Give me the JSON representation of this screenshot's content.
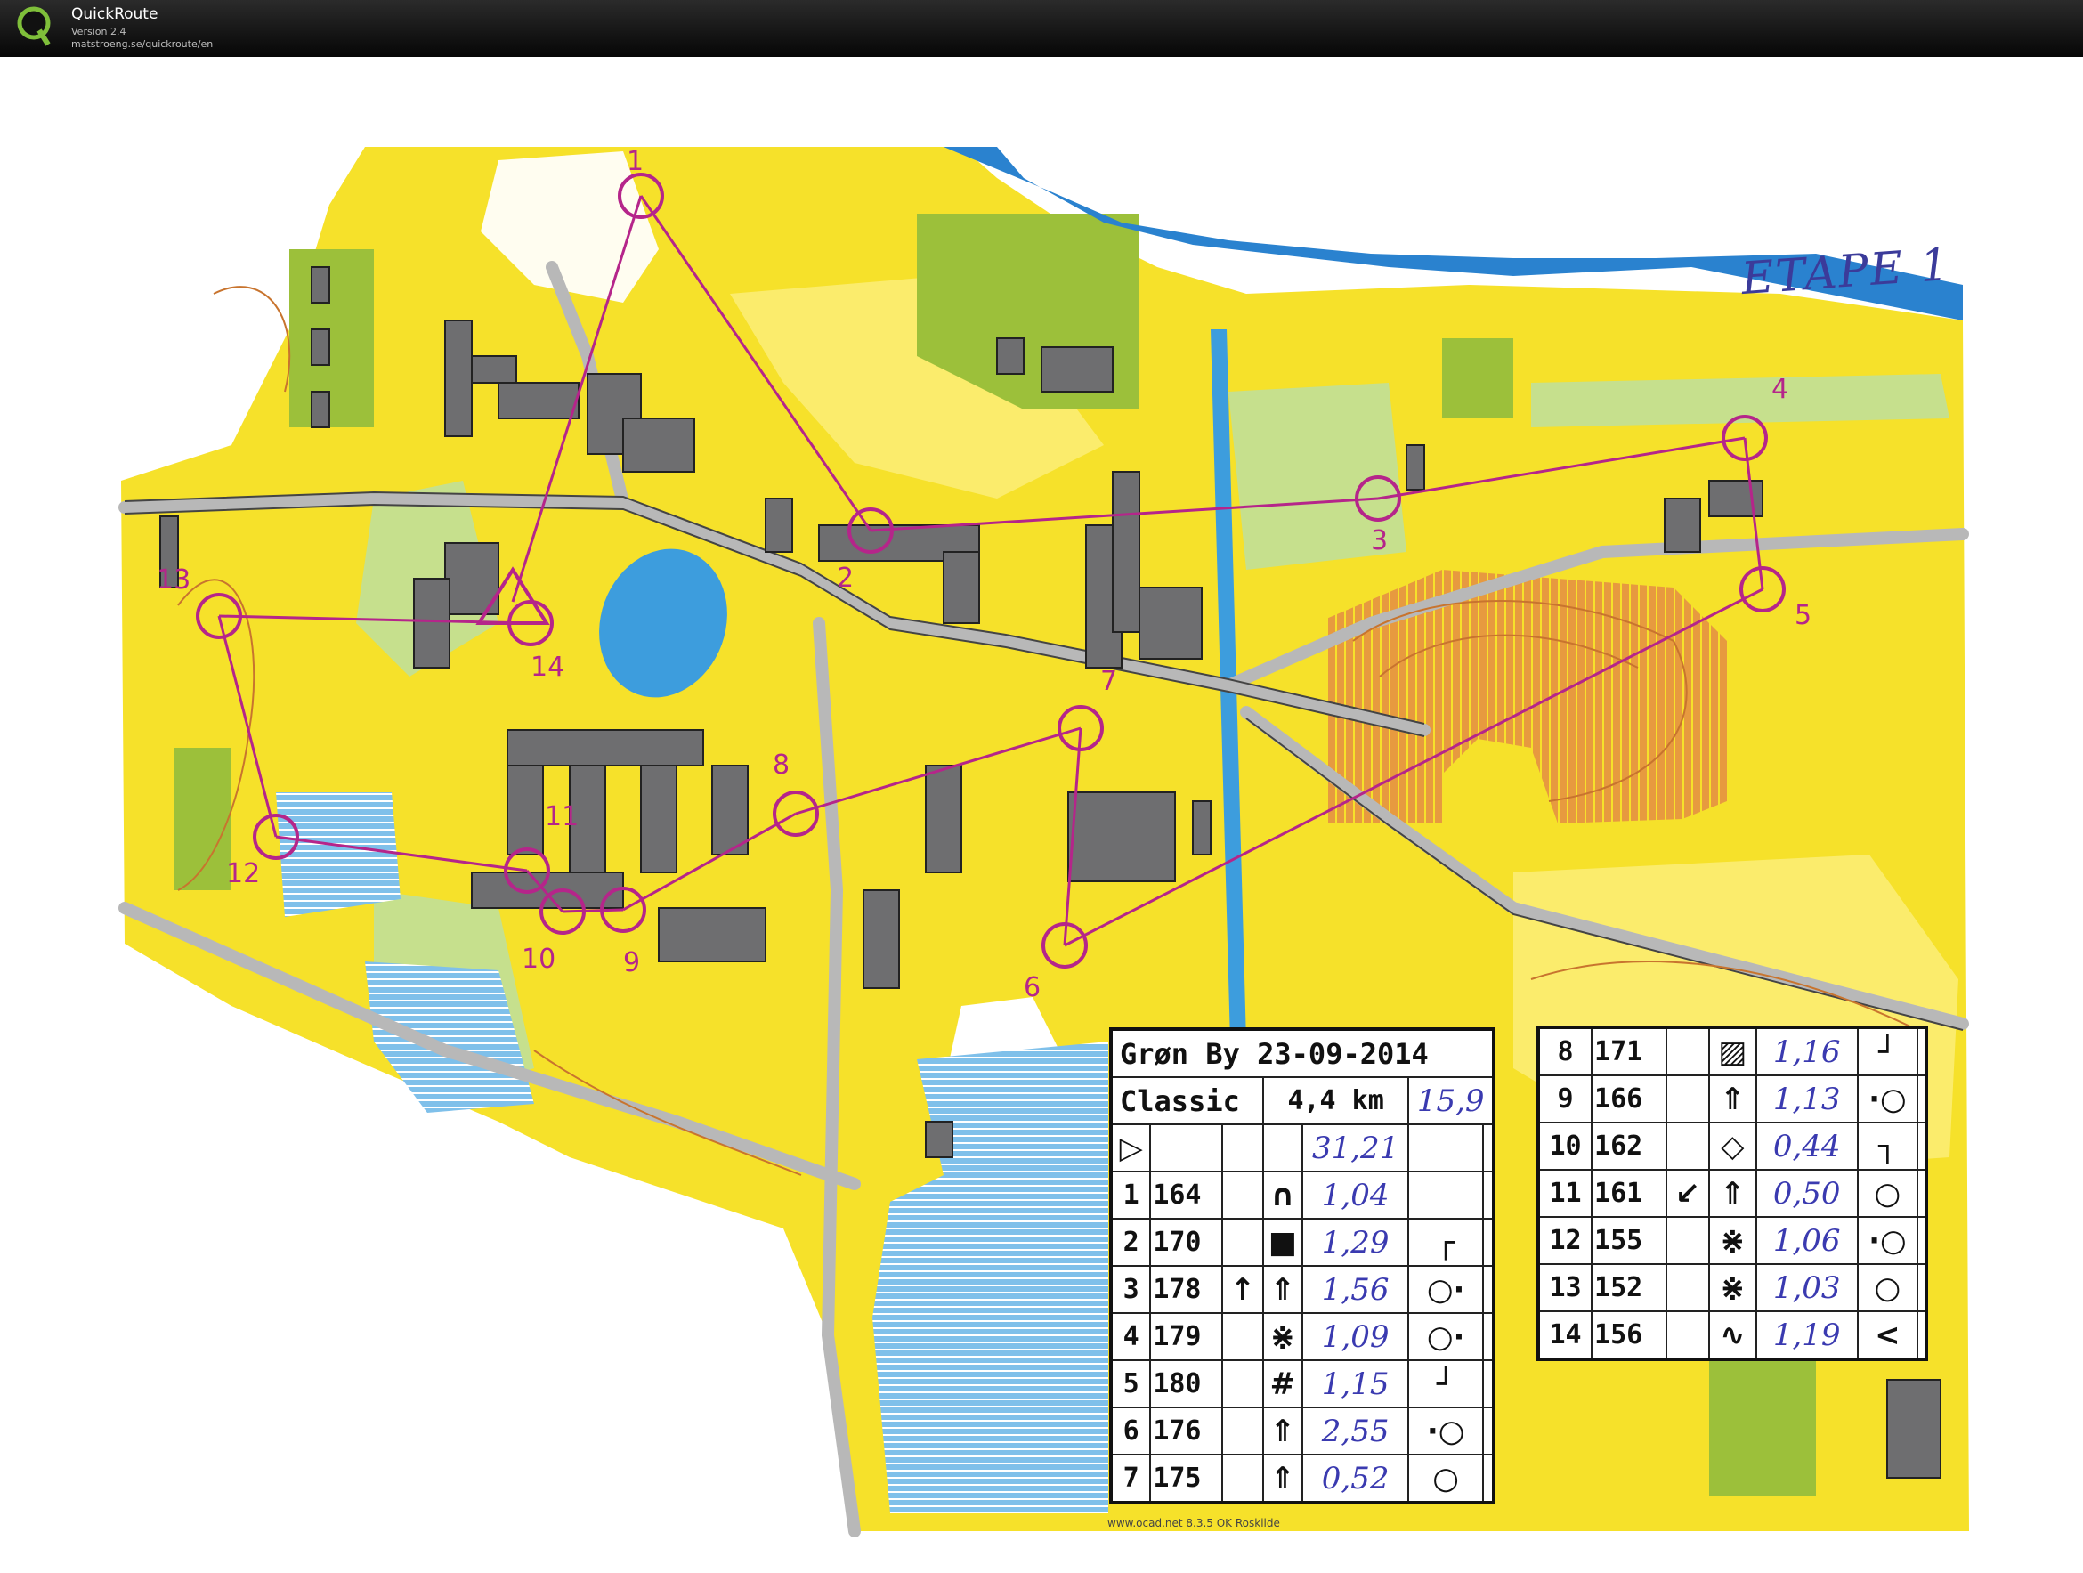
{
  "app": {
    "title": "QuickRoute",
    "version": "Version 2.4",
    "url": "matstroeng.se/quickroute/en"
  },
  "map": {
    "stage_note": "ETAPE 1",
    "footer": "www.ocad.net 8.3.5 OK Roskilde",
    "colors": {
      "open_land": "#f6e12a",
      "rough_open": "#fbec6c",
      "forest": "#ffffff",
      "green_dense": "#9cc03a",
      "green_light": "#c6e08d",
      "water": "#3d9ddd",
      "building": "#6e6e70",
      "paved": "#d8d8d8",
      "course": "#b5258a",
      "contour": "#c8742e"
    },
    "controls": [
      {
        "label": "1"
      },
      {
        "label": "2"
      },
      {
        "label": "3"
      },
      {
        "label": "4"
      },
      {
        "label": "5"
      },
      {
        "label": "6"
      },
      {
        "label": "7"
      },
      {
        "label": "8"
      },
      {
        "label": "9"
      },
      {
        "label": "10"
      },
      {
        "label": "11"
      },
      {
        "label": "12"
      },
      {
        "label": "13"
      },
      {
        "label": "14"
      }
    ]
  },
  "description": {
    "event_header": "Grøn By 23-09-2014",
    "class_name": "Classic",
    "distance": "4,4 km",
    "handwritten_total_distance": "15,9",
    "handwritten_total_time": "31,21",
    "start_symbol": "▷",
    "rows_left": [
      {
        "num": "1",
        "code": "164",
        "col3": "",
        "feature": "∩",
        "time": "1,04",
        "note": "",
        "detail": ""
      },
      {
        "num": "2",
        "code": "170",
        "col3": "",
        "feature": "■",
        "time": "1,29",
        "note": "",
        "detail": "┌"
      },
      {
        "num": "3",
        "code": "178",
        "col3": "↑",
        "feature": "⇑",
        "time": "1,56",
        "note": "",
        "detail": "○·"
      },
      {
        "num": "4",
        "code": "179",
        "col3": "",
        "feature": "⋇",
        "time": "1,09",
        "note": "",
        "detail": "○·"
      },
      {
        "num": "5",
        "code": "180",
        "col3": "",
        "feature": "#",
        "time": "1,15",
        "note": "",
        "detail": "┘"
      },
      {
        "num": "6",
        "code": "176",
        "col3": "",
        "feature": "⇑",
        "time": "2,55",
        "note": "",
        "detail": "·○"
      },
      {
        "num": "7",
        "code": "175",
        "col3": "",
        "feature": "⇑",
        "time": "0,52",
        "note": "",
        "detail": "○"
      }
    ],
    "rows_right": [
      {
        "num": "8",
        "code": "171",
        "col3": "",
        "feature": "▨",
        "time": "1,16",
        "detail": "┘"
      },
      {
        "num": "9",
        "code": "166",
        "col3": "",
        "feature": "⇑",
        "time": "1,13",
        "detail": "·○"
      },
      {
        "num": "10",
        "code": "162",
        "col3": "",
        "feature": "◇",
        "time": "0,44",
        "detail": "┐"
      },
      {
        "num": "11",
        "code": "161",
        "col3": "↙",
        "feature": "⇑",
        "time": "0,50",
        "detail": "○"
      },
      {
        "num": "12",
        "code": "155",
        "col3": "",
        "feature": "⋇",
        "time": "1,06",
        "detail": "·○"
      },
      {
        "num": "13",
        "code": "152",
        "col3": "",
        "feature": "⋇",
        "time": "1,03",
        "detail": "○"
      },
      {
        "num": "14",
        "code": "156",
        "col3": "",
        "feature": "∿",
        "time": "1,19",
        "detail": "<"
      }
    ]
  }
}
